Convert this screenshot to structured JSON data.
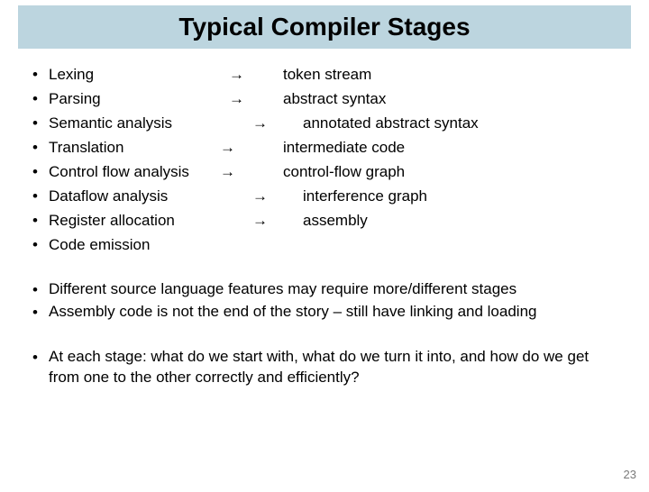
{
  "title": "Typical Compiler Stages",
  "stages": [
    {
      "name": "Lexing",
      "arrow": "→",
      "output": "token stream",
      "arrowPad": "0px",
      "outPad": "0px"
    },
    {
      "name": "Parsing",
      "arrow": "→",
      "output": "abstract syntax",
      "arrowPad": "0px",
      "outPad": "0px"
    },
    {
      "name": "Semantic analysis",
      "arrow": "→",
      "output": "annotated abstract syntax",
      "arrowPad": "26px",
      "outPad": "22px"
    },
    {
      "name": "Translation",
      "arrow": "→",
      "output": "intermediate code",
      "arrowPad": "-10px",
      "outPad": "0px"
    },
    {
      "name": "Control flow analysis",
      "arrow": "→",
      "output": "control-flow graph",
      "arrowPad": "-10px",
      "outPad": "0px"
    },
    {
      "name": "Dataflow analysis",
      "arrow": "→",
      "output": "interference graph",
      "arrowPad": "26px",
      "outPad": "22px"
    },
    {
      "name": "Register allocation",
      "arrow": "→",
      "output": "assembly",
      "arrowPad": "26px",
      "outPad": "22px"
    },
    {
      "name": "Code emission",
      "arrow": "",
      "output": "",
      "arrowPad": "0px",
      "outPad": "0px"
    }
  ],
  "notes_group1": [
    "Different source language features may require more/different stages",
    "Assembly code is not the end of the story – still have linking and loading"
  ],
  "notes_group2": [
    "At each stage: what do we start with, what do we turn it into, and how do we get from one to the other correctly and efficiently?"
  ],
  "bullet_glyph": "•",
  "page_number": "23"
}
